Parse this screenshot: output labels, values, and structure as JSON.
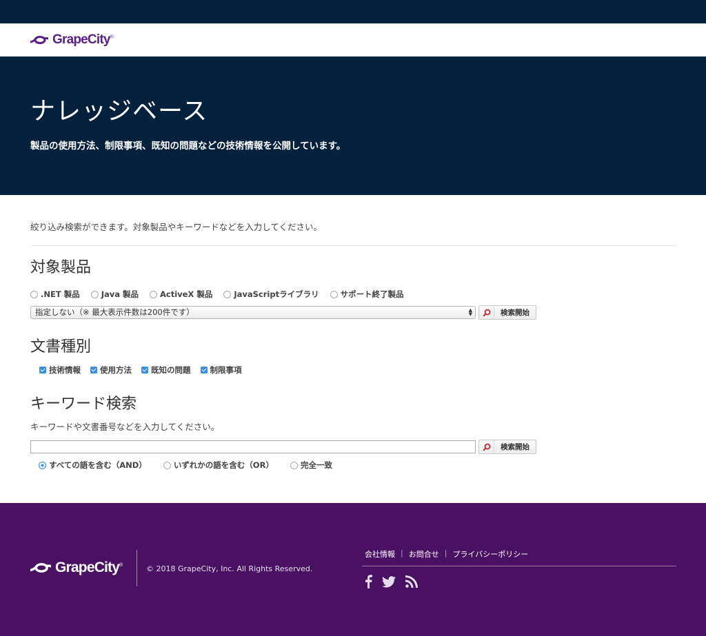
{
  "brand": {
    "name": "GrapeCity",
    "mark": "®",
    "color": "#5a1f86",
    "footer_bg": "#4a1163",
    "hero_bg": "#03203d"
  },
  "hero": {
    "title": "ナレッジベース",
    "subtitle": "製品の使用方法、制限事項、既知の問題などの技術情報を公開しています。"
  },
  "intro": "絞り込み検索ができます。対象製品やキーワードなどを入力してください。",
  "product": {
    "title": "対象製品",
    "options": [
      ".NET 製品",
      "Java 製品",
      "ActiveX 製品",
      "JavaScriptライブラリ",
      "サポート終了製品"
    ],
    "select_value": "指定しない（※ 最大表示件数は200件です）",
    "search_label": "検索開始"
  },
  "doctype": {
    "title": "文書種別",
    "options": [
      "技術情報",
      "使用方法",
      "既知の問題",
      "制限事項"
    ]
  },
  "keyword": {
    "title": "キーワード検索",
    "subtitle": "キーワードや文書番号などを入力してください。",
    "value": "",
    "search_label": "検索開始",
    "modes": [
      "すべての語を含む（AND）",
      "いずれかの語を含む（OR）",
      "完全一致"
    ],
    "selected_mode": "すべての語を含む（AND）"
  },
  "footer": {
    "copyright": "© 2018 GrapeCity, Inc. All Rights Reserved.",
    "links": [
      "会社情報",
      "お問合せ",
      "プライバシーポリシー"
    ],
    "separator": "|",
    "social_icons": [
      "facebook-icon",
      "twitter-icon",
      "rss-icon"
    ]
  }
}
